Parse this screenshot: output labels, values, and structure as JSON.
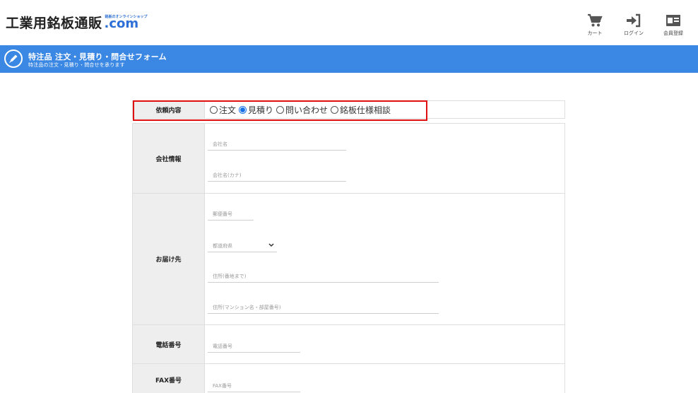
{
  "header": {
    "logo_main": "工業用銘板通販",
    "logo_tagline": "銘板のオンラインショップ",
    "logo_com": ".com",
    "nav": [
      {
        "label": "カート",
        "icon": "cart-icon"
      },
      {
        "label": "ログイン",
        "icon": "login-icon"
      },
      {
        "label": "会員登録",
        "icon": "member-card-icon"
      }
    ]
  },
  "banner": {
    "title": "特注品 注文・見積り・問合せフォーム",
    "subtitle": "特注品の注文・見積り・問合せを承ります",
    "color": "#3a87e4"
  },
  "form": {
    "request": {
      "label": "依頼内容",
      "options": [
        "注文",
        "見積り",
        "問い合わせ",
        "銘板仕様相談"
      ],
      "selected": "見積り"
    },
    "company": {
      "label": "会社情報",
      "company_name_placeholder": "会社名",
      "company_kana_placeholder": "会社名(カナ)"
    },
    "delivery": {
      "label": "お届け先",
      "postal_placeholder": "郵便番号",
      "prefecture_placeholder": "都道府県",
      "address1_placeholder": "住所(番地まで)",
      "address2_placeholder": "住所(マンション名・部屋番号)"
    },
    "tel": {
      "label": "電話番号",
      "placeholder": "電話番号"
    },
    "fax": {
      "label": "FAX番号",
      "placeholder": "FAX番号"
    }
  },
  "colors": {
    "accent": "#3a87e4",
    "highlight": "#e01010"
  }
}
